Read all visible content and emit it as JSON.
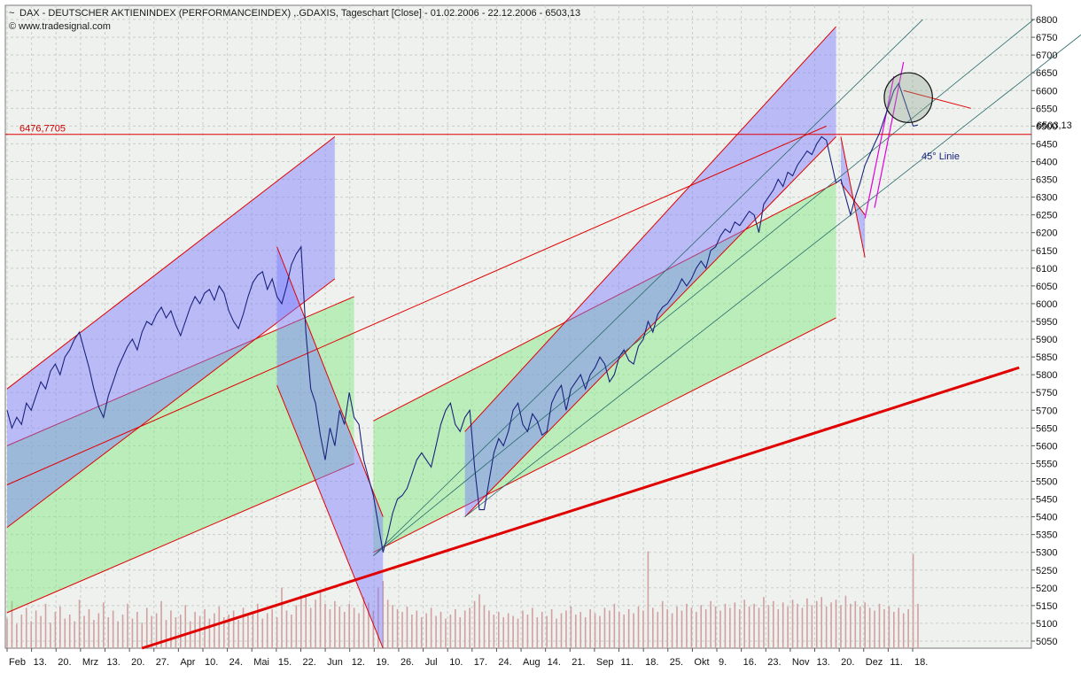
{
  "header": {
    "title": "DAX  - DEUTSCHER AKTIENINDEX (PERFORMANCEINDEX) ,.GDAXIS, Tageschart [Close] - 01.02.2006 - 22.12.2006 - 6503,13",
    "source": "www.tradesignal.com"
  },
  "colors": {
    "price_line": "#1a237e",
    "channel_blue": "#7b7bff",
    "channel_green": "#7de87d",
    "trend_red": "#e00000",
    "grid": "#c8d0c8",
    "background": "#eef1ee",
    "volume": "#d2a0a0"
  },
  "chart_data": {
    "type": "line",
    "ylim": [
      5030,
      6840
    ],
    "yticks": [
      5050,
      5100,
      5150,
      5200,
      5250,
      5300,
      5350,
      5400,
      5450,
      5500,
      5550,
      5600,
      5650,
      5700,
      5750,
      5800,
      5850,
      5900,
      5950,
      6000,
      6050,
      6100,
      6150,
      6200,
      6250,
      6300,
      6350,
      6400,
      6450,
      6500,
      6550,
      6600,
      6650,
      6700,
      6750,
      6800
    ],
    "xticks": [
      "Feb",
      "13.",
      "20.",
      "Mrz",
      "13.",
      "20.",
      "27.",
      "Apr",
      "10.",
      "24.",
      "Mai",
      "15.",
      "22.",
      "Jun",
      "12.",
      "19.",
      "26.",
      "Jul",
      "10.",
      "17.",
      "24.",
      "Aug",
      "14.",
      "21.",
      "Sep",
      "11.",
      "18.",
      "25.",
      "Okt",
      "9.",
      "16.",
      "23.",
      "Nov",
      "13.",
      "20.",
      "Dez",
      "11.",
      "18."
    ],
    "series": [
      {
        "values": [
          5700,
          5650,
          5680,
          5660,
          5720,
          5700,
          5740,
          5780,
          5760,
          5810,
          5830,
          5800,
          5850,
          5870,
          5900,
          5920,
          5870,
          5820,
          5760,
          5710,
          5680,
          5740,
          5780,
          5820,
          5850,
          5880,
          5900,
          5870,
          5920,
          5950,
          5940,
          5970,
          5990,
          5960,
          5980,
          5940,
          5910,
          5950,
          5990,
          6020,
          6000,
          6030,
          6040,
          6010,
          6050,
          6030,
          5980,
          5950,
          5930,
          5970,
          6020,
          6060,
          6080,
          6090,
          6040,
          6070,
          6020,
          6000,
          6050,
          6110,
          6140,
          6160,
          5920,
          5760,
          5720,
          5630,
          5560,
          5650,
          5600,
          5700,
          5660,
          5750,
          5680,
          5660,
          5560,
          5510,
          5460,
          5380,
          5300,
          5350,
          5410,
          5450,
          5460,
          5480,
          5520,
          5560,
          5580,
          5560,
          5540,
          5600,
          5660,
          5700,
          5720,
          5660,
          5640,
          5680,
          5700,
          5540,
          5420,
          5420,
          5500,
          5580,
          5620,
          5600,
          5640,
          5700,
          5720,
          5660,
          5640,
          5690,
          5670,
          5630,
          5640,
          5720,
          5750,
          5770,
          5700,
          5760,
          5780,
          5800,
          5760,
          5800,
          5820,
          5850,
          5830,
          5780,
          5800,
          5850,
          5870,
          5840,
          5830,
          5880,
          5900,
          5950,
          5920,
          5970,
          5990,
          6000,
          6020,
          6040,
          6070,
          6050,
          6070,
          6100,
          6120,
          6100,
          6150,
          6160,
          6190,
          6210,
          6200,
          6230,
          6220,
          6240,
          6260,
          6250,
          6200,
          6280,
          6300,
          6320,
          6350,
          6330,
          6370,
          6360,
          6390,
          6410,
          6430,
          6420,
          6450,
          6470,
          6460,
          6400,
          6340,
          6350,
          6300,
          6250,
          6300,
          6340,
          6390,
          6420,
          6450,
          6480,
          6520,
          6560,
          6600,
          6620,
          6580,
          6540,
          6500,
          6503.13
        ],
        "last_value": 6503.13
      }
    ],
    "volume_ylim": [
      0,
      1
    ],
    "volume_values": [
      0.22,
      0.35,
      0.18,
      0.25,
      0.3,
      0.2,
      0.28,
      0.24,
      0.33,
      0.19,
      0.27,
      0.31,
      0.22,
      0.25,
      0.2,
      0.36,
      0.24,
      0.29,
      0.21,
      0.26,
      0.34,
      0.23,
      0.28,
      0.2,
      0.25,
      0.33,
      0.22,
      0.27,
      0.19,
      0.3,
      0.24,
      0.26,
      0.35,
      0.21,
      0.28,
      0.23,
      0.25,
      0.32,
      0.2,
      0.27,
      0.24,
      0.29,
      0.22,
      0.26,
      0.31,
      0.23,
      0.25,
      0.28,
      0.21,
      0.3,
      0.24,
      0.27,
      0.33,
      0.22,
      0.26,
      0.29,
      0.23,
      0.45,
      0.28,
      0.25,
      0.32,
      0.38,
      0.4,
      0.3,
      0.36,
      0.42,
      0.33,
      0.29,
      0.35,
      0.31,
      0.27,
      0.33,
      0.3,
      0.26,
      0.38,
      0.34,
      0.28,
      0.45,
      0.5,
      0.36,
      0.32,
      0.29,
      0.27,
      0.31,
      0.25,
      0.28,
      0.23,
      0.26,
      0.3,
      0.24,
      0.27,
      0.22,
      0.25,
      0.29,
      0.23,
      0.28,
      0.3,
      0.35,
      0.4,
      0.32,
      0.28,
      0.25,
      0.27,
      0.23,
      0.26,
      0.24,
      0.22,
      0.28,
      0.25,
      0.3,
      0.23,
      0.27,
      0.24,
      0.29,
      0.22,
      0.26,
      0.28,
      0.31,
      0.25,
      0.27,
      0.23,
      0.29,
      0.26,
      0.24,
      0.3,
      0.28,
      0.33,
      0.27,
      0.25,
      0.29,
      0.26,
      0.31,
      0.28,
      0.72,
      0.3,
      0.27,
      0.35,
      0.29,
      0.26,
      0.31,
      0.28,
      0.33,
      0.3,
      0.27,
      0.32,
      0.29,
      0.35,
      0.31,
      0.28,
      0.33,
      0.3,
      0.34,
      0.29,
      0.36,
      0.31,
      0.33,
      0.3,
      0.38,
      0.32,
      0.35,
      0.29,
      0.34,
      0.31,
      0.36,
      0.33,
      0.3,
      0.37,
      0.32,
      0.35,
      0.38,
      0.31,
      0.34,
      0.36,
      0.32,
      0.39,
      0.33,
      0.35,
      0.31,
      0.34,
      0.3,
      0.28,
      0.33,
      0.29,
      0.31,
      0.27,
      0.3,
      0.26,
      0.29,
      0.7,
      0.33,
      0.28,
      0.3,
      0.25,
      0.27,
      0.24
    ]
  },
  "overlays": {
    "channels_blue": [
      {
        "upper": [
          [
            0,
            5760
          ],
          [
            68,
            6470
          ]
        ],
        "lower": [
          [
            0,
            5370
          ],
          [
            68,
            6070
          ]
        ]
      },
      {
        "upper": [
          [
            56,
            6160
          ],
          [
            78,
            5400
          ]
        ],
        "lower": [
          [
            56,
            5770
          ],
          [
            78,
            5030
          ]
        ]
      },
      {
        "upper": [
          [
            95,
            5640
          ],
          [
            172,
            6780
          ]
        ],
        "lower": [
          [
            95,
            5400
          ],
          [
            172,
            6470
          ]
        ]
      },
      {
        "upper": [
          [
            173,
            6470
          ],
          [
            178,
            6130
          ]
        ],
        "lower": [
          [
            173,
            6340
          ],
          [
            178,
            6250
          ]
        ]
      }
    ],
    "channels_green": [
      {
        "upper": [
          [
            0,
            5600
          ],
          [
            72,
            6020
          ]
        ],
        "lower": [
          [
            0,
            5130
          ],
          [
            72,
            5550
          ]
        ]
      },
      {
        "upper": [
          [
            76,
            5670
          ],
          [
            172,
            6340
          ]
        ],
        "lower": [
          [
            76,
            5300
          ],
          [
            172,
            5960
          ]
        ]
      }
    ],
    "trend_lines": [
      {
        "from": [
          28,
          5030
        ],
        "to": [
          210,
          5820
        ],
        "color": "#e00000",
        "width": 3
      },
      {
        "from": [
          0,
          5490
        ],
        "to": [
          170,
          6500
        ],
        "color": "#e00000",
        "width": 1
      },
      {
        "from": [
          180,
          6270
        ],
        "to": [
          186,
          6680
        ],
        "color": "#e000e0",
        "width": 1.2
      },
      {
        "from": [
          178,
          6240
        ],
        "to": [
          184,
          6640
        ],
        "color": "#e000e0",
        "width": 1.2
      },
      {
        "from": [
          186,
          6600
        ],
        "to": [
          200,
          6550
        ],
        "color": "#e00000",
        "width": 1
      }
    ],
    "fan_lines": [
      {
        "from": [
          76,
          5290
        ],
        "to": [
          190,
          6800
        ]
      },
      {
        "from": [
          76,
          5290
        ],
        "to": [
          213,
          6800
        ]
      },
      {
        "from": [
          95,
          5400
        ],
        "to": [
          225,
          6780
        ]
      }
    ],
    "hline": {
      "value": 6476.7705,
      "label": "6476,7705"
    },
    "price_label": "6503,13",
    "angle_label": "45° Linie",
    "circle": {
      "center": [
        187,
        6580
      ],
      "radius_x": 5,
      "radius_y": 70
    }
  }
}
